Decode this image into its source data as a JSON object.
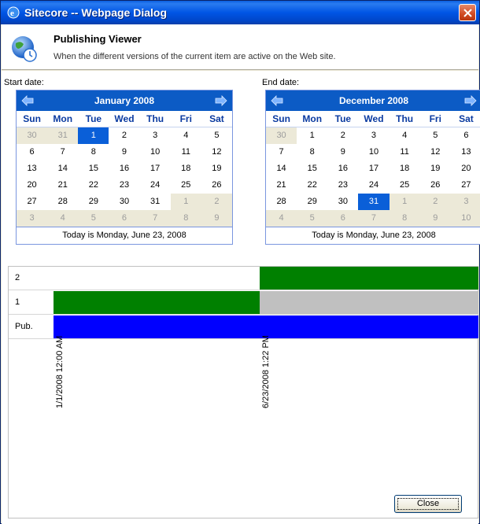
{
  "window": {
    "title": "Sitecore -- Webpage Dialog"
  },
  "header": {
    "title": "Publishing Viewer",
    "subtitle": "When the different versions of the current item are active on the Web site."
  },
  "start_calendar": {
    "label": "Start date:",
    "month": "January 2008",
    "days_of_week": [
      "Sun",
      "Mon",
      "Tue",
      "Wed",
      "Thu",
      "Fri",
      "Sat"
    ],
    "weeks": [
      [
        "30",
        "31",
        "1",
        "2",
        "3",
        "4",
        "5"
      ],
      [
        "6",
        "7",
        "8",
        "9",
        "10",
        "11",
        "12"
      ],
      [
        "13",
        "14",
        "15",
        "16",
        "17",
        "18",
        "19"
      ],
      [
        "20",
        "21",
        "22",
        "23",
        "24",
        "25",
        "26"
      ],
      [
        "27",
        "28",
        "29",
        "30",
        "31",
        "1",
        "2"
      ],
      [
        "3",
        "4",
        "5",
        "6",
        "7",
        "8",
        "9"
      ]
    ],
    "today_text": "Today is Monday, June 23, 2008"
  },
  "end_calendar": {
    "label": "End date:",
    "month": "December 2008",
    "days_of_week": [
      "Sun",
      "Mon",
      "Tue",
      "Wed",
      "Thu",
      "Fri",
      "Sat"
    ],
    "weeks": [
      [
        "30",
        "1",
        "2",
        "3",
        "4",
        "5",
        "6"
      ],
      [
        "7",
        "8",
        "9",
        "10",
        "11",
        "12",
        "13"
      ],
      [
        "14",
        "15",
        "16",
        "17",
        "18",
        "19",
        "20"
      ],
      [
        "21",
        "22",
        "23",
        "24",
        "25",
        "26",
        "27"
      ],
      [
        "28",
        "29",
        "30",
        "31",
        "1",
        "2",
        "3"
      ],
      [
        "4",
        "5",
        "6",
        "7",
        "8",
        "9",
        "10"
      ]
    ],
    "today_text": "Today is Monday, June 23, 2008"
  },
  "timeline": {
    "rows": [
      {
        "label": "2"
      },
      {
        "label": "1"
      },
      {
        "label": "Pub."
      }
    ],
    "date_markers": [
      "1/1/2008 12:00 AM",
      "6/23/2008 1:22 PM"
    ]
  },
  "buttons": {
    "close": "Close"
  },
  "colors": {
    "title_bar": "#0055e5",
    "active_version": "#008000",
    "inactive_version": "#c0c0c0",
    "published": "#0000ff",
    "selected_day": "#0a5fd8"
  }
}
